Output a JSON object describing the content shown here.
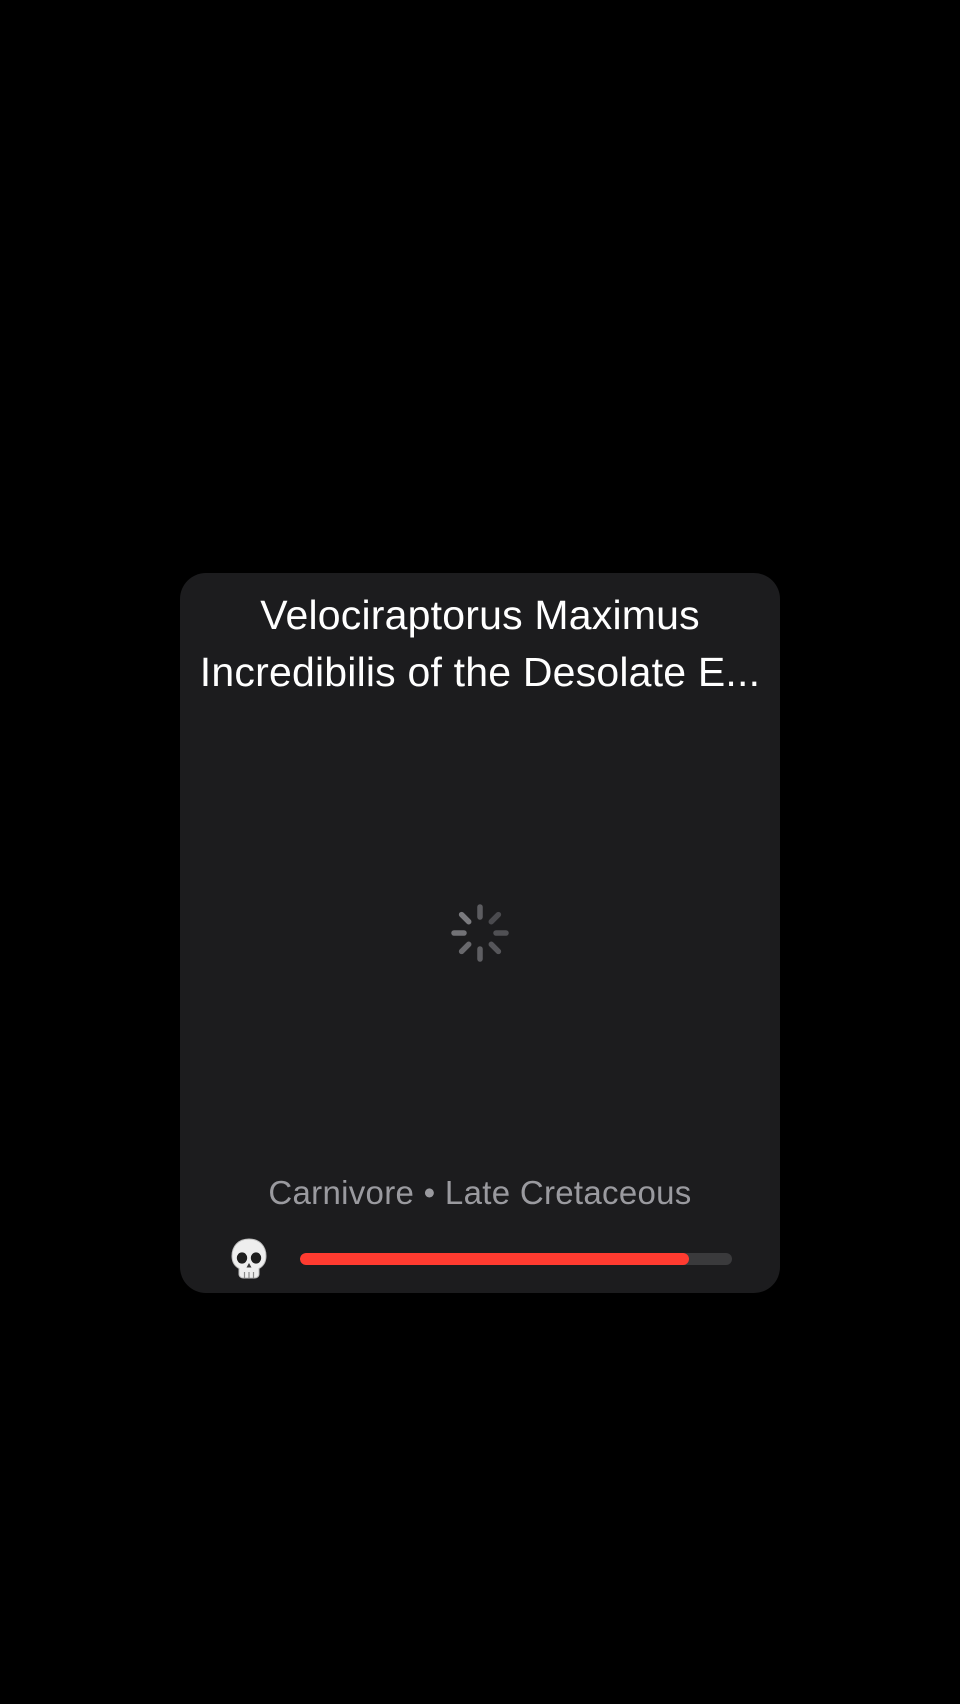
{
  "card": {
    "title_line1": "Velociraptorus Maximus",
    "title_line2": "Incredibilis of the Desolate E...",
    "subtitle": "Carnivore • Late Cretaceous",
    "loading_indicator": "spinner-icon",
    "danger": {
      "icon": "skull-icon",
      "level": 0.9,
      "fill_color": "#ff3b30",
      "track_color": "#3a3a3c"
    }
  }
}
